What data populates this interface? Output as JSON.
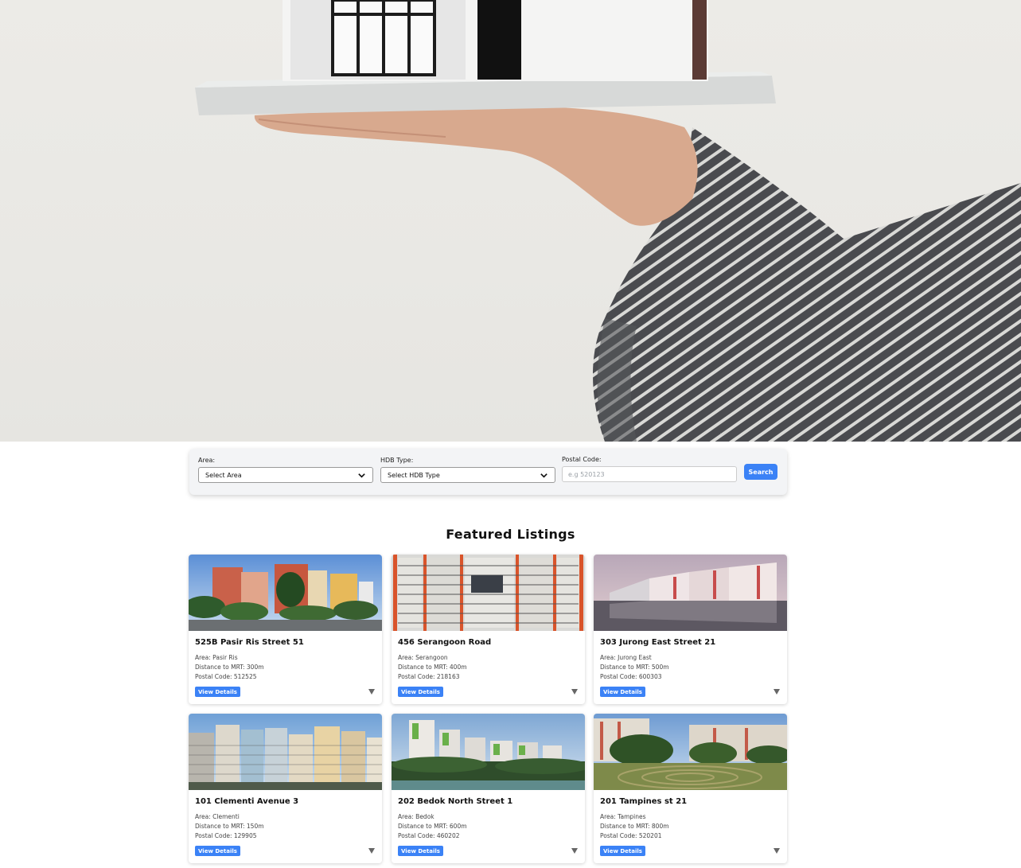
{
  "hero": {
    "image": "hand-holding-house-model"
  },
  "search": {
    "area_label": "Area:",
    "area_value": "Select Area",
    "hdb_label": "HDB Type:",
    "hdb_value": "Select HDB Type",
    "postal_label": "Postal Code:",
    "postal_placeholder": "e.g 520123",
    "button": "Search"
  },
  "featured": {
    "title": "Featured Listings",
    "listings": [
      {
        "name": "525B Pasir Ris Street 51",
        "area": "Area: Pasir Ris",
        "mrt": "Distance to MRT: 300m",
        "postal": "Postal Code: 512525",
        "button": "View Details"
      },
      {
        "name": "456 Serangoon Road",
        "area": "Area: Serangoon",
        "mrt": "Distance to MRT: 400m",
        "postal": "Postal Code: 218163",
        "button": "View Details"
      },
      {
        "name": "303 Jurong East Street 21",
        "area": "Area: Jurong East",
        "mrt": "Distance to MRT: 500m",
        "postal": "Postal Code: 600303",
        "button": "View Details"
      },
      {
        "name": "101 Clementi Avenue 3",
        "area": "Area: Clementi",
        "mrt": "Distance to MRT: 150m",
        "postal": "Postal Code: 129905",
        "button": "View Details"
      },
      {
        "name": "202 Bedok North Street 1",
        "area": "Area: Bedok",
        "mrt": "Distance to MRT: 600m",
        "postal": "Postal Code: 460202",
        "button": "View Details"
      },
      {
        "name": "201 Tampines st 21",
        "area": "Area: Tampines",
        "mrt": "Distance to MRT: 800m",
        "postal": "Postal Code: 520201",
        "button": "View Details"
      }
    ]
  },
  "colors": {
    "accent": "#3b82f6"
  }
}
